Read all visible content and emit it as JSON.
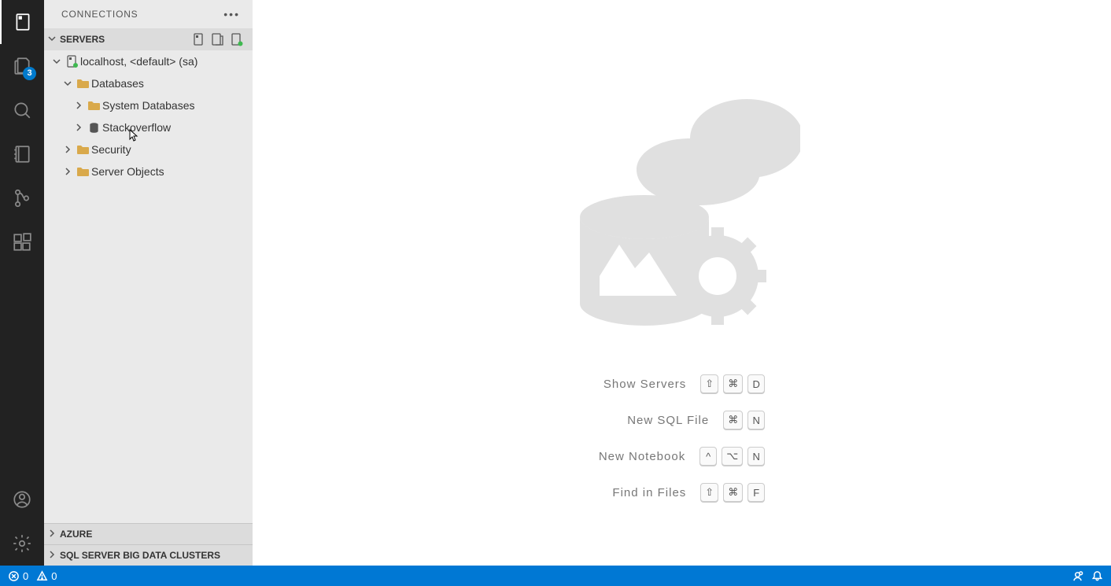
{
  "panel": {
    "title": "CONNECTIONS"
  },
  "sections": {
    "servers": {
      "title": "SERVERS"
    },
    "azure": {
      "title": "AZURE"
    },
    "bigdata": {
      "title": "SQL SERVER BIG DATA CLUSTERS"
    }
  },
  "tree": {
    "server": {
      "label": "localhost, <default> (sa)"
    },
    "databases": {
      "label": "Databases"
    },
    "systemdb": {
      "label": "System Databases"
    },
    "stackoverflow": {
      "label": "Stackoverflow"
    },
    "security": {
      "label": "Security"
    },
    "serverobjects": {
      "label": "Server Objects"
    }
  },
  "badges": {
    "explorer": "3"
  },
  "welcome": {
    "shortcuts": [
      {
        "label": "Show Servers",
        "keys": [
          "⇧",
          "⌘",
          "D"
        ]
      },
      {
        "label": "New SQL File",
        "keys": [
          "⌘",
          "N"
        ]
      },
      {
        "label": "New Notebook",
        "keys": [
          "^",
          "⌥",
          "N"
        ]
      },
      {
        "label": "Find in Files",
        "keys": [
          "⇧",
          "⌘",
          "F"
        ]
      }
    ]
  },
  "status": {
    "errors": "0",
    "warnings": "0"
  }
}
